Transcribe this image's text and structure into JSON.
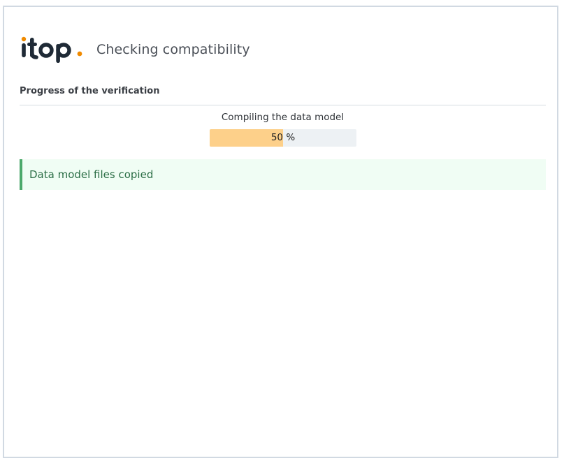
{
  "header": {
    "brand": "itop",
    "title": "Checking compatibility"
  },
  "section": {
    "title": "Progress of the verification"
  },
  "progress": {
    "step_label": "Compiling the data model",
    "percent": 50,
    "text": "50 %"
  },
  "alert": {
    "message": "Data model files copied",
    "type": "success"
  },
  "colors": {
    "accent_orange": "#f08a00",
    "logo_dark": "#1f2a36",
    "progress_fill": "#fdd08a",
    "progress_track": "#edf1f4",
    "success_border": "#4ca96b",
    "success_bg": "#f0fdf4",
    "success_text": "#2b6e46"
  }
}
